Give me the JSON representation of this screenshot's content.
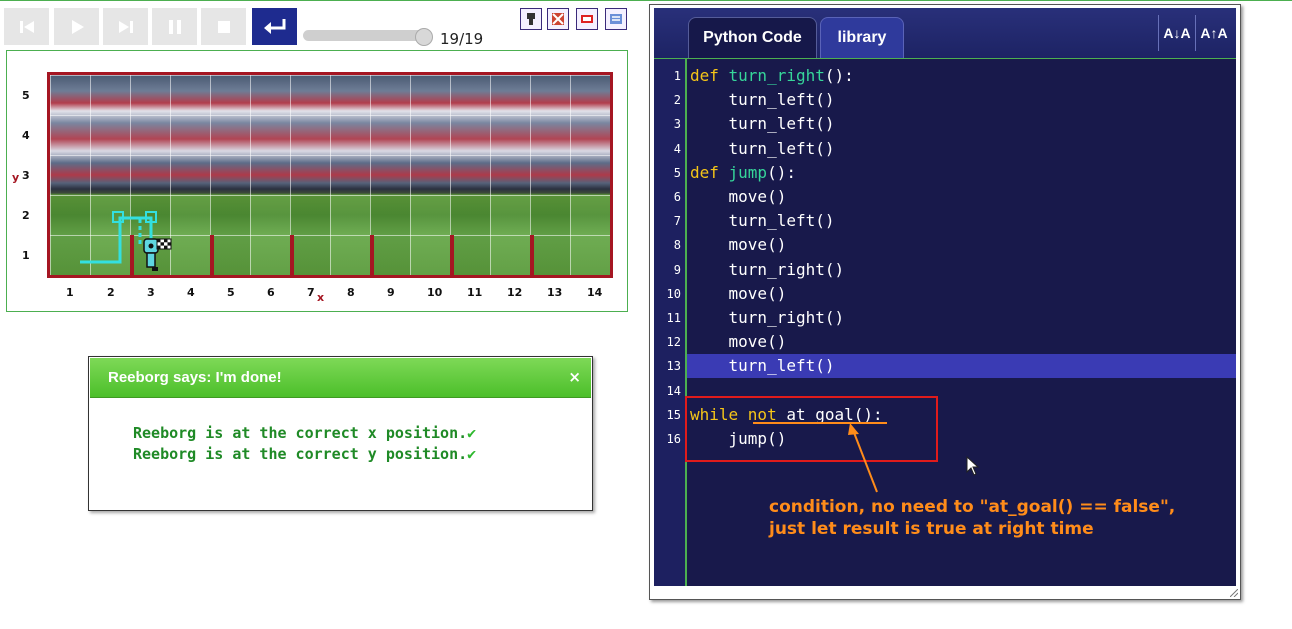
{
  "toolbar": {
    "buttons": [
      "reload-icon",
      "run-icon",
      "step-icon",
      "pause-icon",
      "stop-icon",
      "return-icon"
    ],
    "step_counter": "19/19",
    "slider_fraction": 0.92
  },
  "world": {
    "y_axis_labels": [
      "5",
      "4",
      "3",
      "2",
      "1"
    ],
    "x_axis_labels": [
      "1",
      "2",
      "3",
      "4",
      "5",
      "6",
      "7",
      "8",
      "9",
      "10",
      "11",
      "12",
      "13",
      "14"
    ],
    "x_axis_name": "x",
    "y_axis_name": "y",
    "colors": {
      "border": "#a51622",
      "trace": "#33e0e0"
    }
  },
  "dialog": {
    "title": "Reeborg says: I'm done!",
    "close": "×",
    "messages": [
      "Reeborg is at the correct x position.",
      "Reeborg is at the correct y position."
    ],
    "check": "✔"
  },
  "editor": {
    "tabs": {
      "active": "Python Code",
      "inactive": "library"
    },
    "font_buttons": [
      "A↓A",
      "A↑A"
    ],
    "highlight_line": 13,
    "lines": [
      {
        "n": "1",
        "segments": [
          {
            "t": "def ",
            "c": "kw"
          },
          {
            "t": "turn_right",
            "c": "fn"
          },
          {
            "t": "():",
            "c": ""
          }
        ]
      },
      {
        "n": "2",
        "segments": [
          {
            "t": "    turn_left()",
            "c": ""
          }
        ]
      },
      {
        "n": "3",
        "segments": [
          {
            "t": "    turn_left()",
            "c": ""
          }
        ]
      },
      {
        "n": "4",
        "segments": [
          {
            "t": "    turn_left()",
            "c": ""
          }
        ]
      },
      {
        "n": "5",
        "segments": [
          {
            "t": "def ",
            "c": "kw"
          },
          {
            "t": "jump",
            "c": "fn"
          },
          {
            "t": "():",
            "c": ""
          }
        ]
      },
      {
        "n": "6",
        "segments": [
          {
            "t": "    move()",
            "c": ""
          }
        ]
      },
      {
        "n": "7",
        "segments": [
          {
            "t": "    turn_left()",
            "c": ""
          }
        ]
      },
      {
        "n": "8",
        "segments": [
          {
            "t": "    move()",
            "c": ""
          }
        ]
      },
      {
        "n": "9",
        "segments": [
          {
            "t": "    turn_right()",
            "c": ""
          }
        ]
      },
      {
        "n": "10",
        "segments": [
          {
            "t": "    move()",
            "c": ""
          }
        ]
      },
      {
        "n": "11",
        "segments": [
          {
            "t": "    turn_right()",
            "c": ""
          }
        ]
      },
      {
        "n": "12",
        "segments": [
          {
            "t": "    move()",
            "c": ""
          }
        ]
      },
      {
        "n": "13",
        "segments": [
          {
            "t": "    turn_left()",
            "c": ""
          }
        ]
      },
      {
        "n": "14",
        "segments": [
          {
            "t": "",
            "c": ""
          }
        ]
      },
      {
        "n": "15",
        "segments": [
          {
            "t": "while ",
            "c": "kw"
          },
          {
            "t": "not ",
            "c": "kw"
          },
          {
            "t": "at_goal():",
            "c": ""
          }
        ]
      },
      {
        "n": "16",
        "segments": [
          {
            "t": "    jump()",
            "c": ""
          }
        ]
      }
    ],
    "annotation": "condition, no need to \"at_goal() == false\", just let result is true at right time",
    "annotation_color": "#ff8c1a"
  }
}
